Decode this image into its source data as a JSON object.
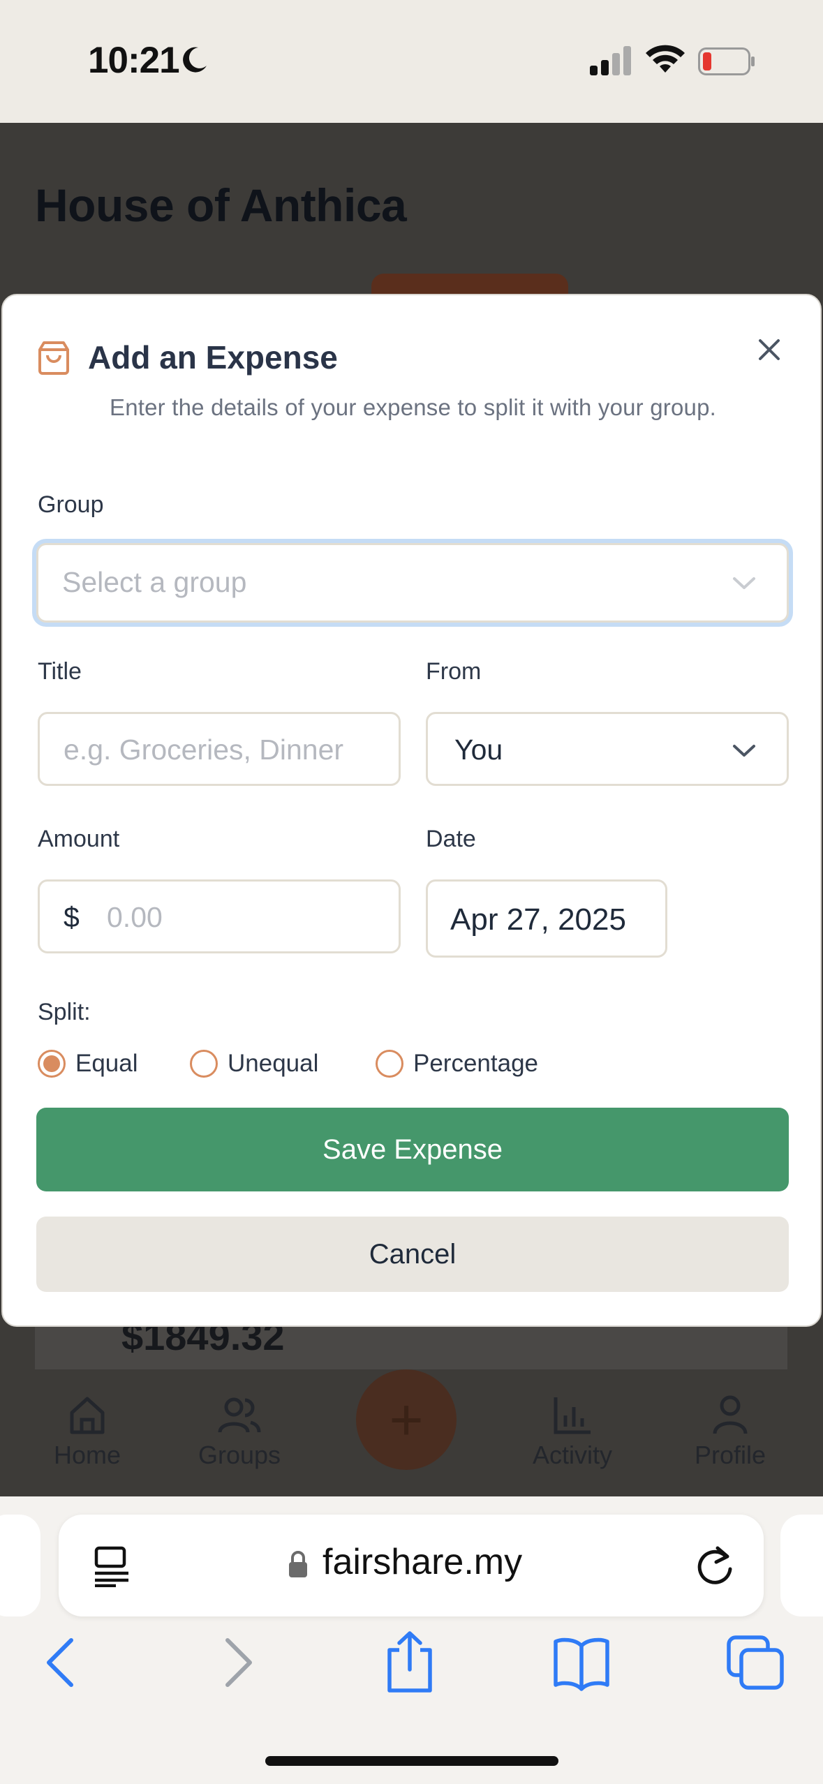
{
  "status_bar": {
    "time": "10:21"
  },
  "background_app": {
    "title": "House of Anthica",
    "amount": "$1849.32",
    "nav": [
      {
        "label": "Home",
        "icon": "home-icon"
      },
      {
        "label": "Groups",
        "icon": "users-icon"
      },
      {
        "label": "Activity",
        "icon": "bar-chart-icon"
      },
      {
        "label": "Profile",
        "icon": "user-icon"
      }
    ],
    "fab_symbol": "+"
  },
  "modal": {
    "title": "Add an Expense",
    "subtitle": "Enter the details of your expense to split it with your group.",
    "icon": "shopping-bag-icon",
    "close_icon": "close-icon",
    "group": {
      "label": "Group",
      "placeholder": "Select a group"
    },
    "title_field": {
      "label": "Title",
      "placeholder": "e.g. Groceries, Dinner"
    },
    "from_field": {
      "label": "From",
      "value": "You"
    },
    "amount_field": {
      "label": "Amount",
      "currency": "$",
      "placeholder": "0.00"
    },
    "date_field": {
      "label": "Date",
      "value": "Apr 27, 2025"
    },
    "split": {
      "label": "Split:",
      "options": [
        {
          "label": "Equal",
          "selected": true
        },
        {
          "label": "Unequal",
          "selected": false
        },
        {
          "label": "Percentage",
          "selected": false
        }
      ]
    },
    "save_label": "Save Expense",
    "cancel_label": "Cancel"
  },
  "browser": {
    "url": "fairshare.my",
    "toolbar": [
      "back-icon",
      "forward-icon",
      "share-icon",
      "bookmarks-icon",
      "tabs-icon"
    ]
  },
  "colors": {
    "accent": "#d98c5f",
    "save_button": "#45976b",
    "focus_ring": "#c5dcf5",
    "ios_blue": "#2f7bf6"
  }
}
